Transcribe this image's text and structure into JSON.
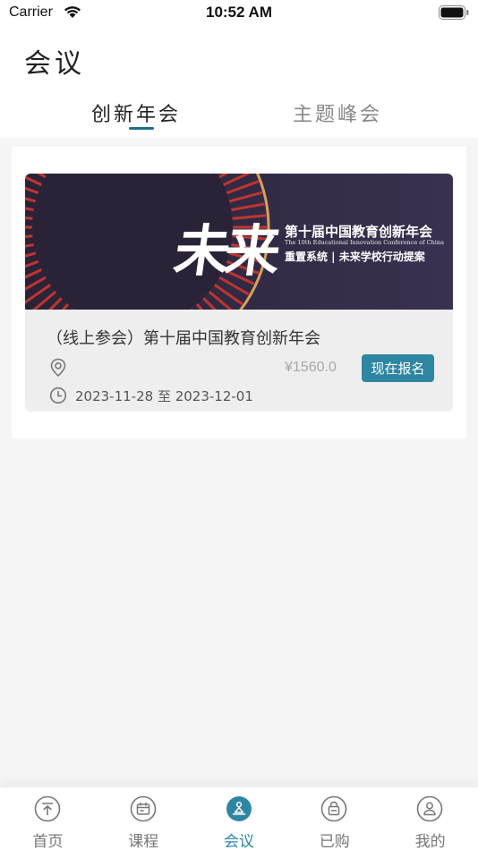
{
  "status_bar": {
    "carrier": "Carrier",
    "time": "10:52 AM"
  },
  "header": {
    "title": "会议",
    "tabs": [
      {
        "label": "创新年会",
        "active": true
      },
      {
        "label": "主题峰会",
        "active": false
      }
    ]
  },
  "conference": {
    "banner": {
      "big_text": "未来",
      "title": "第十届中国教育创新年会",
      "english": "The 10th Educational Innovation Conference of China",
      "subtitle": "重置系统 | 未来学校行动提案"
    },
    "title": "（线上参会）第十届中国教育创新年会",
    "price": "¥1560.0",
    "register_label": "现在报名",
    "date_range": "2023-11-28 至 2023-12-01",
    "location_icon": "location-pin-icon",
    "time_icon": "clock-icon"
  },
  "tabbar": {
    "items": [
      {
        "label": "首页",
        "icon": "home-top-icon"
      },
      {
        "label": "课程",
        "icon": "course-icon"
      },
      {
        "label": "会议",
        "icon": "meeting-icon",
        "active": true
      },
      {
        "label": "已购",
        "icon": "purchased-icon"
      },
      {
        "label": "我的",
        "icon": "profile-icon"
      }
    ]
  },
  "colors": {
    "accent": "#2e86a2",
    "banner_bg": "#2a2338",
    "banner_red": "#c0352f",
    "banner_gold": "#d8a15a"
  }
}
